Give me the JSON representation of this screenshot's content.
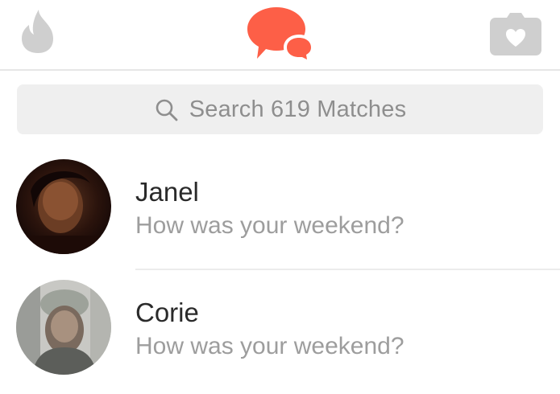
{
  "nav": {
    "left_icon": "flame-icon",
    "center_icon": "messages-icon",
    "right_icon": "moments-camera-icon",
    "active_color": "#fd5f47",
    "inactive_color": "#cfcfcf"
  },
  "search": {
    "placeholder": "Search 619 Matches",
    "icon": "search-icon"
  },
  "matches": [
    {
      "name": "Janel",
      "last_message": "How was your weekend?"
    },
    {
      "name": "Corie",
      "last_message": "How was your weekend?"
    }
  ]
}
